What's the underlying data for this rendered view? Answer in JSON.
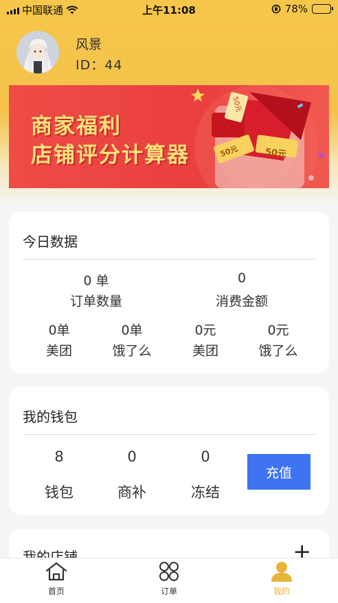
{
  "status_bar": {
    "carrier": "中国联通",
    "time": "上午11:08",
    "battery": "78%"
  },
  "profile": {
    "name": "风景",
    "id_label": "ID：44"
  },
  "banner": {
    "line1": "商家福利",
    "line2": "店铺评分计算器",
    "coupon1": "50元",
    "coupon2": "50元",
    "coupon3": "50元"
  },
  "today": {
    "title": "今日数据",
    "orders_value": "0 单",
    "orders_label": "订单数量",
    "spend_value": "0",
    "spend_label": "消费金额",
    "platforms": [
      {
        "value": "0单",
        "label": "美团"
      },
      {
        "value": "0单",
        "label": "饿了么"
      },
      {
        "value": "0元",
        "label": "美团"
      },
      {
        "value": "0元",
        "label": "饿了么"
      }
    ]
  },
  "wallet": {
    "title": "我的钱包",
    "items": [
      {
        "value": "8",
        "label": "钱包"
      },
      {
        "value": "0",
        "label": "商补"
      },
      {
        "value": "0",
        "label": "冻结"
      }
    ],
    "recharge_label": "充值"
  },
  "store": {
    "title": "我的店铺",
    "add_symbol": "+"
  },
  "tabbar": {
    "tabs": [
      {
        "label": "首页"
      },
      {
        "label": "订单"
      },
      {
        "label": "我的"
      }
    ],
    "active_color": "#e8b339"
  }
}
